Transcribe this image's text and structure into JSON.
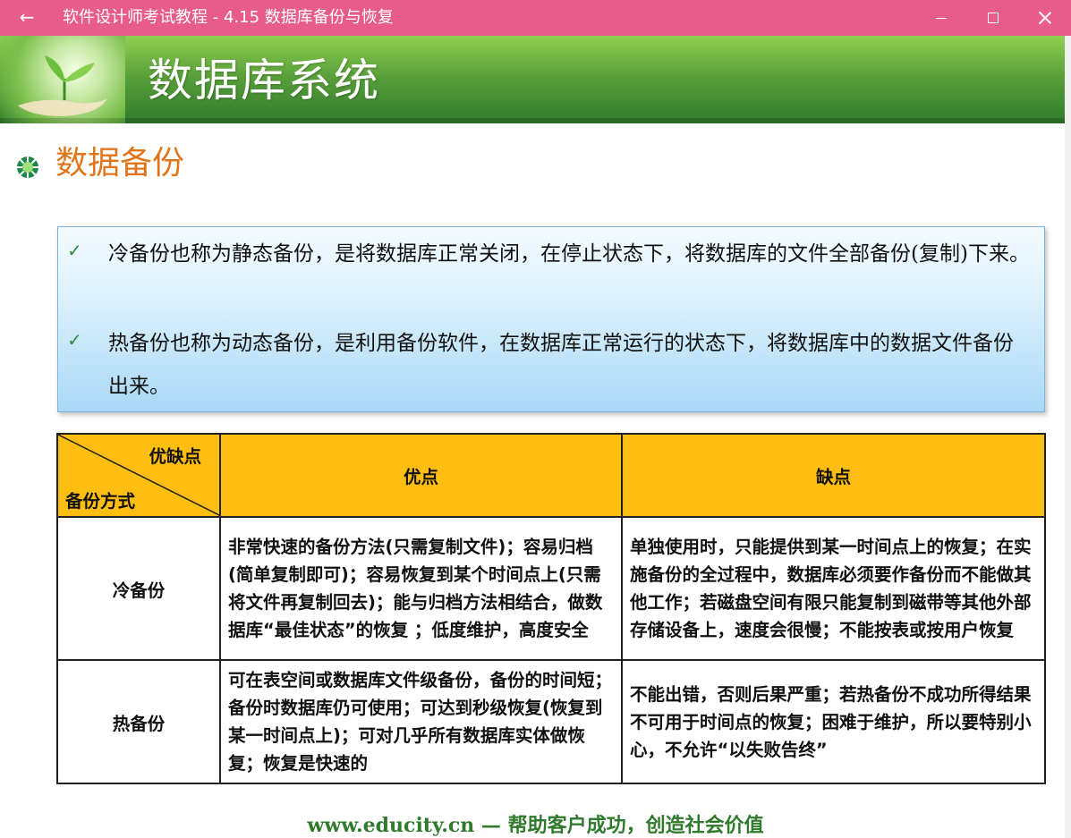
{
  "window": {
    "title": "软件设计师考试教程 - 4.15  数据库备份与恢复",
    "back_glyph": "←",
    "controls": {
      "minimize": "minimize",
      "maximize": "maximize",
      "close": "close"
    }
  },
  "slide": {
    "banner_title": "数据库系统",
    "section_title": "数据备份",
    "bullets": [
      {
        "mark": "✓",
        "text": "冷备份也称为静态备份，是将数据库正常关闭，在停止状态下，将数据库的文件全部备份(复制)下来。"
      },
      {
        "mark": "✓",
        "text": "热备份也称为动态备份，是利用备份软件，在数据库正常运行的状态下，将数据库中的数据文件备份出来。"
      }
    ],
    "table": {
      "corner_top": "优缺点",
      "corner_bottom": "备份方式",
      "col_pros": "优点",
      "col_cons": "缺点",
      "rows": [
        {
          "name": "冷备份",
          "pros": "非常快速的备份方法(只需复制文件)；容易归档(简单复制即可)；容易恢复到某个时间点上(只需将文件再复制回去)；能与归档方法相结合，做数据库“最佳状态”的恢复 ；低度维护，高度安全",
          "cons": "单独使用时，只能提供到某一时间点上的恢复；在实施备份的全过程中，数据库必须要作备份而不能做其他工作；若磁盘空间有限只能复制到磁带等其他外部存储设备上，速度会很慢；不能按表或按用户恢复"
        },
        {
          "name": "热备份",
          "pros": "可在表空间或数据库文件级备份，备份的时间短；备份时数据库仍可使用；可达到秒级恢复(恢复到某一时间点上)；可对几乎所有数据库实体做恢复；恢复是快速的",
          "cons": "不能出错，否则后果严重；若热备份不成功所得结果不可用于时间点的恢复；困难于维护，所以要特别小心，不允许“以失败告终”"
        }
      ]
    },
    "footer": "www.educity.cn — 帮助客户成功，创造社会价值"
  },
  "colors": {
    "titlebar": "#e85c8c",
    "banner_green": "#5aa13a",
    "section_orange": "#e0761c",
    "table_header": "#fdbd11",
    "footer_green": "#2f7a2c"
  }
}
